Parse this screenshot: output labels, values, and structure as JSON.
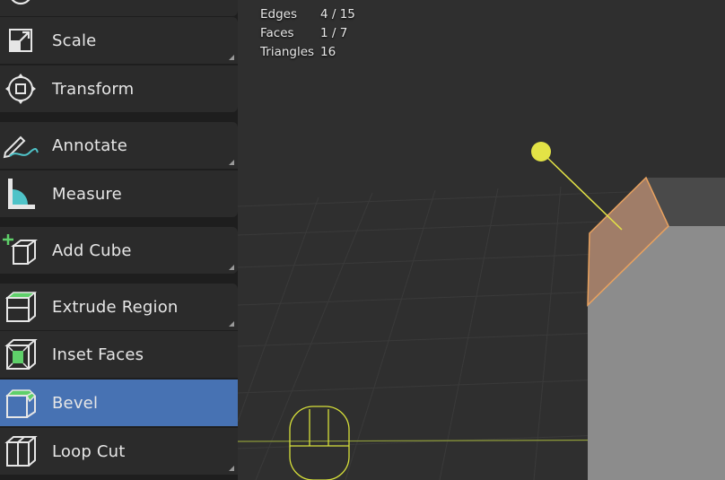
{
  "stats": [
    {
      "label": "Edges",
      "value": "4 / 15"
    },
    {
      "label": "Faces",
      "value": "1 / 7"
    },
    {
      "label": "Triangles",
      "value": "16"
    }
  ],
  "tools": [
    {
      "label": "",
      "icon": "rotate-icon"
    },
    {
      "label": "Scale",
      "icon": "scale-icon"
    },
    {
      "label": "Transform",
      "icon": "transform-icon"
    },
    {
      "label": "Annotate",
      "icon": "annotate-icon"
    },
    {
      "label": "Measure",
      "icon": "measure-icon"
    },
    {
      "label": "Add Cube",
      "icon": "add-cube-icon"
    },
    {
      "label": "Extrude Region",
      "icon": "extrude-region-icon"
    },
    {
      "label": "Inset Faces",
      "icon": "inset-faces-icon"
    },
    {
      "label": "Bevel",
      "icon": "bevel-icon",
      "active": true
    },
    {
      "label": "Loop Cut",
      "icon": "loop-cut-icon"
    }
  ],
  "colors": {
    "active_tool": "#4772b3",
    "selected_face": "#e9a25f",
    "gizmo": "#e3e346"
  }
}
